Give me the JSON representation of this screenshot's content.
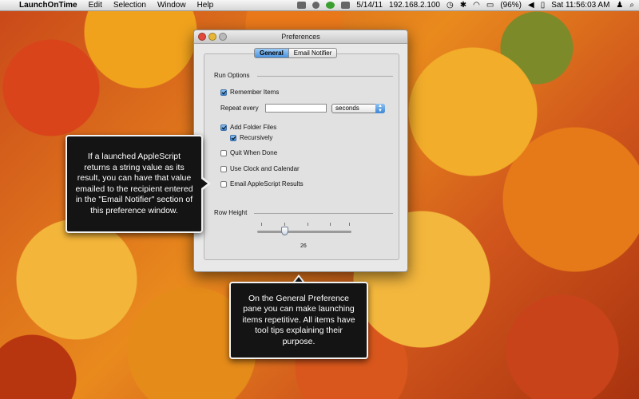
{
  "menubar": {
    "apple": "",
    "app_name": "LaunchOnTime",
    "menus": [
      "Edit",
      "Selection",
      "Window",
      "Help"
    ],
    "status": {
      "date": "5/14/11",
      "ip": "192.168.2.100",
      "battery": "(96%)",
      "clock": "Sat 11:56:03 AM"
    }
  },
  "window": {
    "title": "Preferences",
    "tabs": [
      {
        "label": "General",
        "selected": true
      },
      {
        "label": "Email Notifier",
        "selected": false
      }
    ],
    "run_options": {
      "heading": "Run Options",
      "remember_items": {
        "label": "Remember Items",
        "checked": true
      },
      "repeat_every": {
        "label": "Repeat every",
        "value": "",
        "unit": "seconds"
      },
      "add_folder_files": {
        "label": "Add Folder Files",
        "checked": true
      },
      "recursively": {
        "label": "Recursively",
        "checked": true
      },
      "quit_when_done": {
        "label": "Quit When Done",
        "checked": false
      },
      "use_clock": {
        "label": "Use Clock and Calendar",
        "checked": false
      },
      "email_results": {
        "label": "Email AppleScript Results",
        "checked": false
      }
    },
    "row_height": {
      "heading": "Row Height",
      "value": "26",
      "slider_fraction": 0.29
    }
  },
  "callouts": {
    "left": "If a launched AppleScript returns a string value as its result, you can have that value emailed to the recipient entered in the \"Email Notifier\" section of this preference window.",
    "bottom": "On the General Preference pane you can make launching items repetitive. All items have tool tips explaining their purpose."
  },
  "colors": {
    "accent": "#3a86d6",
    "callout_bg": "#141414",
    "callout_border": "#f2f2f2"
  }
}
